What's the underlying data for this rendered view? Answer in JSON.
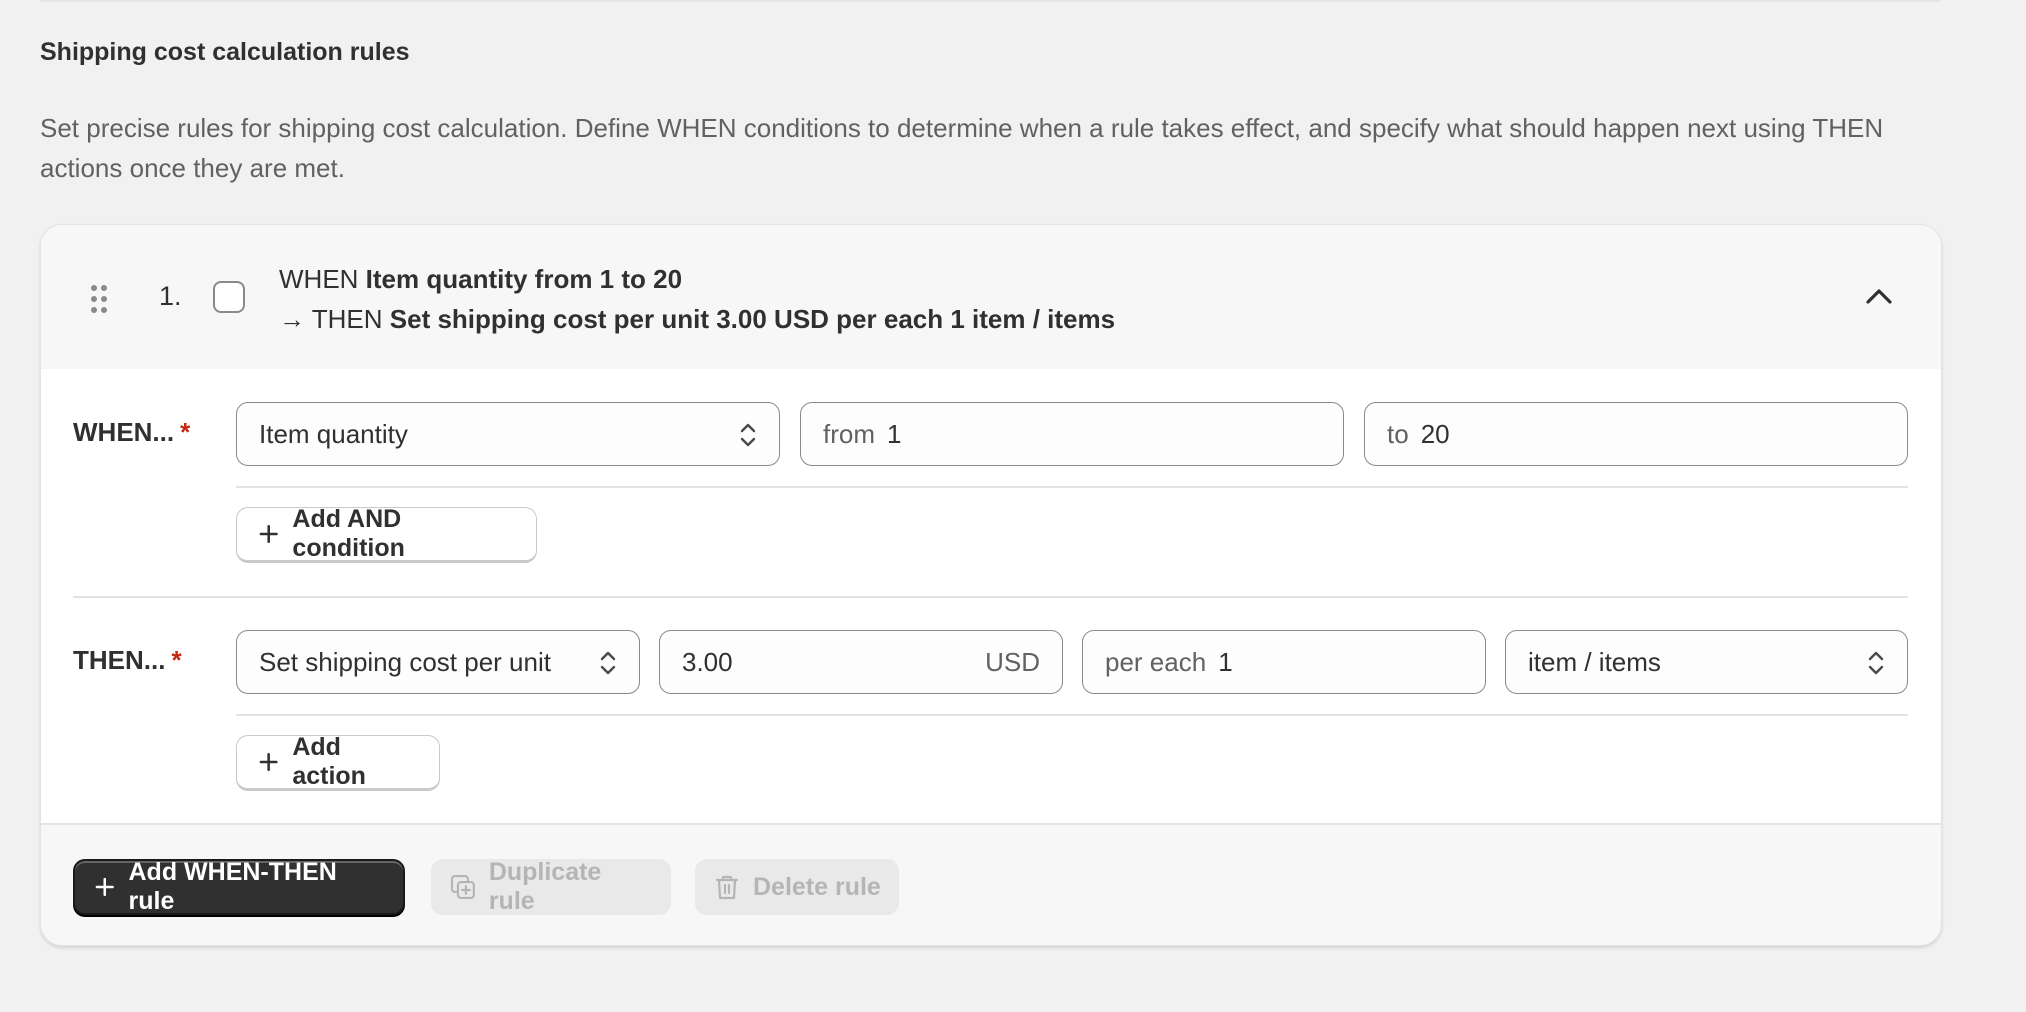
{
  "section": {
    "title": "Shipping cost calculation rules",
    "description": "Set precise rules for shipping cost calculation. Define WHEN conditions to determine when a rule takes effect, and specify what should happen next using THEN actions once they are met."
  },
  "rule": {
    "number": "1.",
    "summary_when_prefix": "WHEN ",
    "summary_when": "Item quantity from 1 to 20",
    "summary_then_prefix": "→ THEN ",
    "summary_then": "Set shipping cost per unit 3.00 USD per each 1 item / items",
    "checked": false,
    "expanded": true
  },
  "when": {
    "label": "WHEN...",
    "required_mark": "*",
    "condition_select": "Item quantity",
    "from_prefix": "from",
    "from_value": "1",
    "to_prefix": "to",
    "to_value": "20",
    "add_condition_label": "Add AND condition"
  },
  "then": {
    "label": "THEN...",
    "required_mark": "*",
    "action_select": "Set shipping cost per unit",
    "cost_value": "3.00",
    "currency": "USD",
    "per_each_prefix": "per each",
    "per_each_value": "1",
    "unit_select": "item / items",
    "add_action_label": "Add action"
  },
  "footer": {
    "add_rule_label": "Add WHEN-THEN rule",
    "duplicate_label": "Duplicate rule",
    "delete_label": "Delete rule"
  },
  "icons": {
    "drag": "drag-handle-icon",
    "collapse": "chevron-up-icon",
    "select": "select-arrows-icon",
    "plus": "plus-icon",
    "duplicate": "duplicate-icon",
    "delete": "trash-icon"
  },
  "colors": {
    "primary_button": "#303030",
    "required": "#c5280c",
    "disabled_text": "#b5b5b5"
  }
}
